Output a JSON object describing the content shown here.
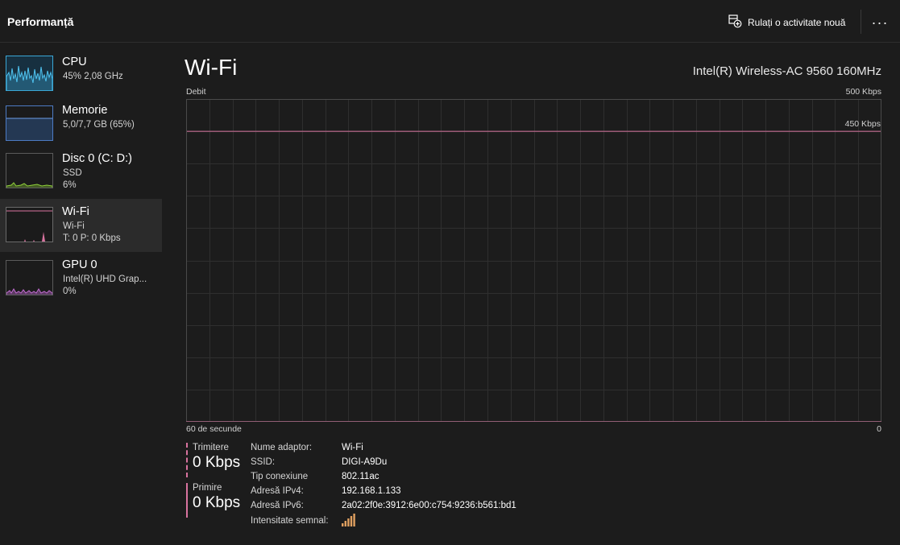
{
  "header": {
    "title": "Performanță",
    "run_task_label": "Rulați o activitate nouă",
    "more_label": "···"
  },
  "sidebar": {
    "items": [
      {
        "name": "CPU",
        "lines": [
          "45% 2,08 GHz"
        ]
      },
      {
        "name": "Memorie",
        "lines": [
          "5,0/7,7 GB (65%)"
        ]
      },
      {
        "name": "Disc 0 (C: D:)",
        "lines": [
          "SSD",
          "6%"
        ]
      },
      {
        "name": "Wi-Fi",
        "lines": [
          "Wi-Fi",
          "T: 0 P: 0 Kbps"
        ]
      },
      {
        "name": "GPU 0",
        "lines": [
          "Intel(R) UHD Grap...",
          "0%"
        ]
      }
    ],
    "selected_index": 3
  },
  "main": {
    "title": "Wi-Fi",
    "adapter_name": "Intel(R) Wireless-AC 9560 160MHz",
    "graph": {
      "label": "Debit",
      "max_label": "500 Kbps",
      "scale_line_label": "450 Kbps",
      "time_label": "60 de secunde",
      "zero_label": "0"
    },
    "send": {
      "label": "Trimitere",
      "value": "0 Kbps"
    },
    "receive": {
      "label": "Primire",
      "value": "0 Kbps"
    },
    "properties": [
      {
        "key": "Nume adaptor:",
        "value": "Wi-Fi"
      },
      {
        "key": "SSID:",
        "value": "DIGI-A9Du"
      },
      {
        "key": "Tip conexiune",
        "value": "802.11ac"
      },
      {
        "key": "Adresă IPv4:",
        "value": "192.168.1.133"
      },
      {
        "key": "Adresă IPv6:",
        "value": "2a02:2f0e:3912:6e00:c754:9236:b561:bd1"
      },
      {
        "key": "Intensitate semnal:",
        "value": ""
      }
    ],
    "signal_bars": 5
  },
  "colors": {
    "background": "#1c1c1c",
    "cpu": "#3aa7d6",
    "memory": "#4d7bc4",
    "disk": "#7fb832",
    "network": "#d8739f",
    "gpu": "#c06bd0",
    "signal": "#e0a060"
  },
  "chart_data": {
    "type": "area",
    "ylim": [
      0,
      500
    ],
    "reference_line": 450,
    "series": [
      {
        "name": "Primire",
        "style": "solid-fill",
        "values": [
          0,
          0,
          0,
          0,
          0,
          0,
          0,
          0,
          0,
          0,
          0,
          0,
          0,
          0,
          0,
          0,
          0,
          0,
          0,
          0,
          0,
          0,
          0,
          0,
          0,
          0,
          0,
          0,
          0,
          0,
          0,
          0,
          0,
          0,
          0,
          0,
          0,
          0,
          0,
          0,
          0,
          0,
          0,
          0,
          0,
          0,
          0,
          0,
          0,
          0,
          0,
          0,
          0,
          0,
          0,
          0,
          0,
          0,
          0,
          0,
          0
        ]
      },
      {
        "name": "Trimitere",
        "style": "dashed",
        "values": [
          0,
          0,
          0,
          0,
          0,
          0,
          0,
          0,
          0,
          0,
          0,
          0,
          0,
          0,
          0,
          0,
          0,
          0,
          0,
          0,
          0,
          0,
          0,
          0,
          0,
          0,
          0,
          0,
          0,
          0,
          0,
          0,
          0,
          0,
          0,
          0,
          0,
          0,
          0,
          0,
          0,
          0,
          0,
          0,
          0,
          0,
          0,
          0,
          0,
          0,
          0,
          0,
          0,
          0,
          0,
          0,
          0,
          0,
          0,
          0,
          0
        ]
      }
    ]
  }
}
